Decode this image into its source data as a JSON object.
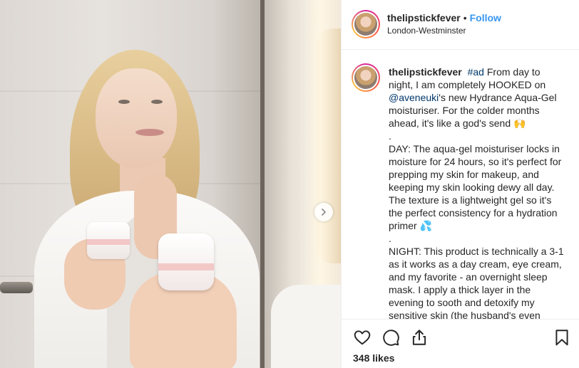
{
  "post": {
    "username": "thelipstickfever",
    "separator": "•",
    "follow_label": "Follow",
    "location": "London-Westminster"
  },
  "caption": {
    "username": "thelipstickfever",
    "hashtag": "#ad",
    "p1_text": "From day to night, I am completely HOOKED on",
    "mention": "@aveneuki",
    "p1_rest": "'s new Hydrance Aqua-Gel moisturiser. For the colder months ahead, it's like a god's send",
    "p1_emoji": "🙌",
    "dot1": ".",
    "p2": "DAY: The aqua-gel moisturiser locks in moisture for 24 hours, so it's perfect for prepping my skin for makeup, and keeping my skin looking dewy all day. The texture is a lightweight gel so it's the perfect consistency for a hydration primer",
    "p2_emoji": "💦",
    "dot2": ".",
    "p3": "NIGHT: This product is technically a 3-1 as it works as a day cream, eye cream, and my favorite - an overnight sleep mask. I apply a thick layer in the evening to sooth and detoxify my sensitive skin (the husband's even"
  },
  "icons": {
    "like": "heart-icon",
    "comment": "comment-icon",
    "share": "share-icon",
    "save": "bookmark-icon",
    "next": "chevron-right-icon"
  },
  "likes": "348 likes"
}
